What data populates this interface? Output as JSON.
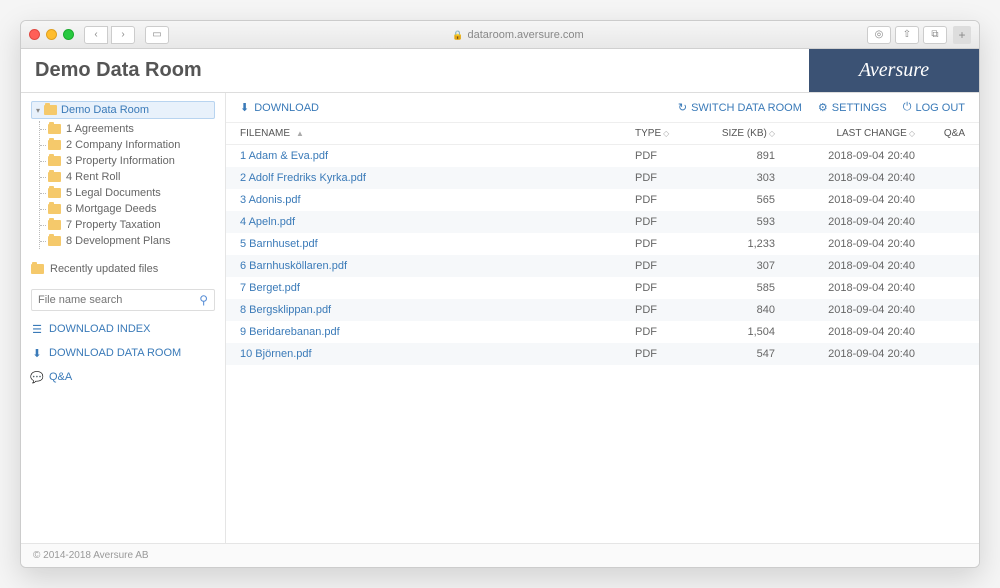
{
  "browser": {
    "url": "dataroom.aversure.com"
  },
  "header": {
    "title": "Demo Data Room",
    "brand": "Aversure"
  },
  "sidebar": {
    "root_label": "Demo Data Room",
    "folders": [
      {
        "label": "1 Agreements"
      },
      {
        "label": "2 Company Information"
      },
      {
        "label": "3 Property Information"
      },
      {
        "label": "4 Rent Roll"
      },
      {
        "label": "5 Legal Documents"
      },
      {
        "label": "6 Mortgage Deeds"
      },
      {
        "label": "7 Property Taxation"
      },
      {
        "label": "8 Development Plans"
      }
    ],
    "recent_label": "Recently updated files",
    "search_placeholder": "File name search",
    "download_index": "DOWNLOAD INDEX",
    "download_room": "DOWNLOAD DATA ROOM",
    "qa_label": "Q&A"
  },
  "toolbar": {
    "download": "DOWNLOAD",
    "switch": "SWITCH DATA ROOM",
    "settings": "SETTINGS",
    "logout": "LOG OUT"
  },
  "table": {
    "headers": {
      "filename": "FILENAME",
      "type": "TYPE",
      "size": "SIZE (KB)",
      "last_change": "LAST CHANGE",
      "qa": "Q&A"
    },
    "rows": [
      {
        "name": "1 Adam & Eva.pdf",
        "type": "PDF",
        "size": "891",
        "changed": "2018-09-04 20:40"
      },
      {
        "name": "2 Adolf Fredriks Kyrka.pdf",
        "type": "PDF",
        "size": "303",
        "changed": "2018-09-04 20:40"
      },
      {
        "name": "3 Adonis.pdf",
        "type": "PDF",
        "size": "565",
        "changed": "2018-09-04 20:40"
      },
      {
        "name": "4 Apeln.pdf",
        "type": "PDF",
        "size": "593",
        "changed": "2018-09-04 20:40"
      },
      {
        "name": "5 Barnhuset.pdf",
        "type": "PDF",
        "size": "1,233",
        "changed": "2018-09-04 20:40"
      },
      {
        "name": "6 Barnhusköllaren.pdf",
        "type": "PDF",
        "size": "307",
        "changed": "2018-09-04 20:40"
      },
      {
        "name": "7 Berget.pdf",
        "type": "PDF",
        "size": "585",
        "changed": "2018-09-04 20:40"
      },
      {
        "name": "8 Bergsklippan.pdf",
        "type": "PDF",
        "size": "840",
        "changed": "2018-09-04 20:40"
      },
      {
        "name": "9 Beridarebanan.pdf",
        "type": "PDF",
        "size": "1,504",
        "changed": "2018-09-04 20:40"
      },
      {
        "name": "10 Björnen.pdf",
        "type": "PDF",
        "size": "547",
        "changed": "2018-09-04 20:40"
      }
    ]
  },
  "footer": {
    "copyright": "© 2014-2018 Aversure AB"
  }
}
